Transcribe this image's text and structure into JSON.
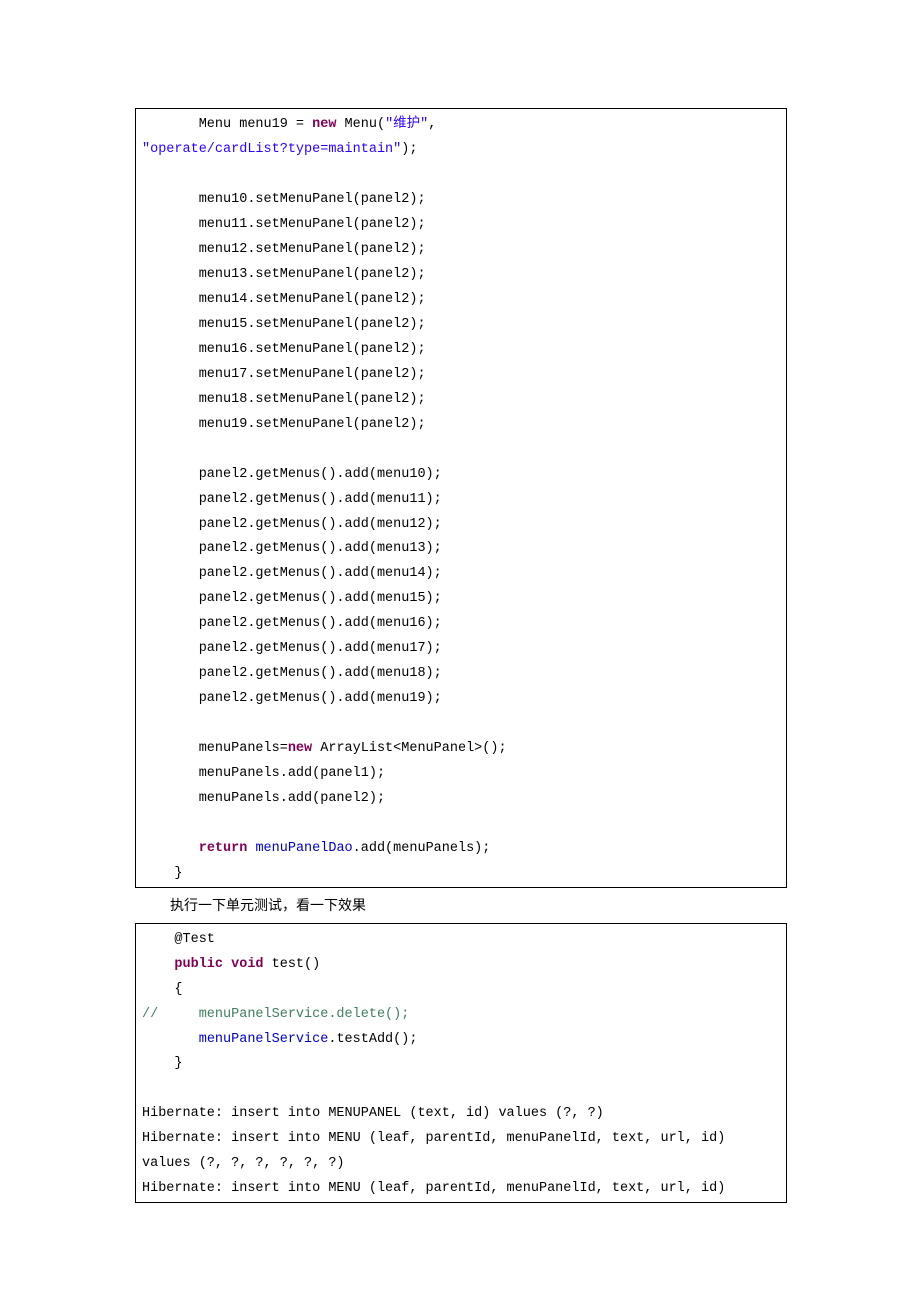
{
  "block1": {
    "l1_a": "       Menu menu19 = ",
    "l1_new": "new",
    "l1_b": " Menu(",
    "l1_str1": "\"维护\"",
    "l1_c": ", ",
    "l2_str": "\"operate/cardList?type=maintain\"",
    "l2_end": ");",
    "blank1": "       ",
    "set10": "       menu10.setMenuPanel(panel2);",
    "set11": "       menu11.setMenuPanel(panel2);",
    "set12": "       menu12.setMenuPanel(panel2);",
    "set13": "       menu13.setMenuPanel(panel2);",
    "set14": "       menu14.setMenuPanel(panel2);",
    "set15": "       menu15.setMenuPanel(panel2);",
    "set16": "       menu16.setMenuPanel(panel2);",
    "set17": "       menu17.setMenuPanel(panel2);",
    "set18": "       menu18.setMenuPanel(panel2);",
    "set19": "       menu19.setMenuPanel(panel2);",
    "blank2": "       ",
    "add10": "       panel2.getMenus().add(menu10);",
    "add11": "       panel2.getMenus().add(menu11);",
    "add12": "       panel2.getMenus().add(menu12);",
    "add13": "       panel2.getMenus().add(menu13);",
    "add14": "       panel2.getMenus().add(menu14);",
    "add15": "       panel2.getMenus().add(menu15);",
    "add16": "       panel2.getMenus().add(menu16);",
    "add17": "       panel2.getMenus().add(menu17);",
    "add18": "       panel2.getMenus().add(menu18);",
    "add19": "       panel2.getMenus().add(menu19);",
    "blank3": "       ",
    "mp1a": "       menuPanels=",
    "mp1_new": "new",
    "mp1b": " ArrayList<MenuPanel>();",
    "mp2": "       menuPanels.add(panel1);",
    "mp3": "       menuPanels.add(panel2);",
    "blank4": "       ",
    "ret_a": "       ",
    "ret_kw": "return",
    "ret_b": " ",
    "ret_fld": "menuPanelDao",
    "ret_c": ".add(menuPanels);",
    "close": "    }"
  },
  "narrative": "执行一下单元测试，看一下效果",
  "block2": {
    "l1": "    @Test",
    "l2_a": "    ",
    "l2_kw1": "public",
    "l2_sp": " ",
    "l2_kw2": "void",
    "l2_b": " test()",
    "l3": "    {",
    "l4_cmt": "//     menuPanelService.delete();",
    "l5_a": "       ",
    "l5_fld": "menuPanelService",
    "l5_b": ".testAdd();",
    "l6": "    }",
    "blank": "",
    "h1": "Hibernate: insert into MENUPANEL (text, id) values (?, ?)",
    "h2": "Hibernate: insert into MENU (leaf, parentId, menuPanelId, text, url, id) ",
    "h3": "values (?, ?, ?, ?, ?, ?)",
    "h4": "Hibernate: insert into MENU (leaf, parentId, menuPanelId, text, url, id) "
  }
}
